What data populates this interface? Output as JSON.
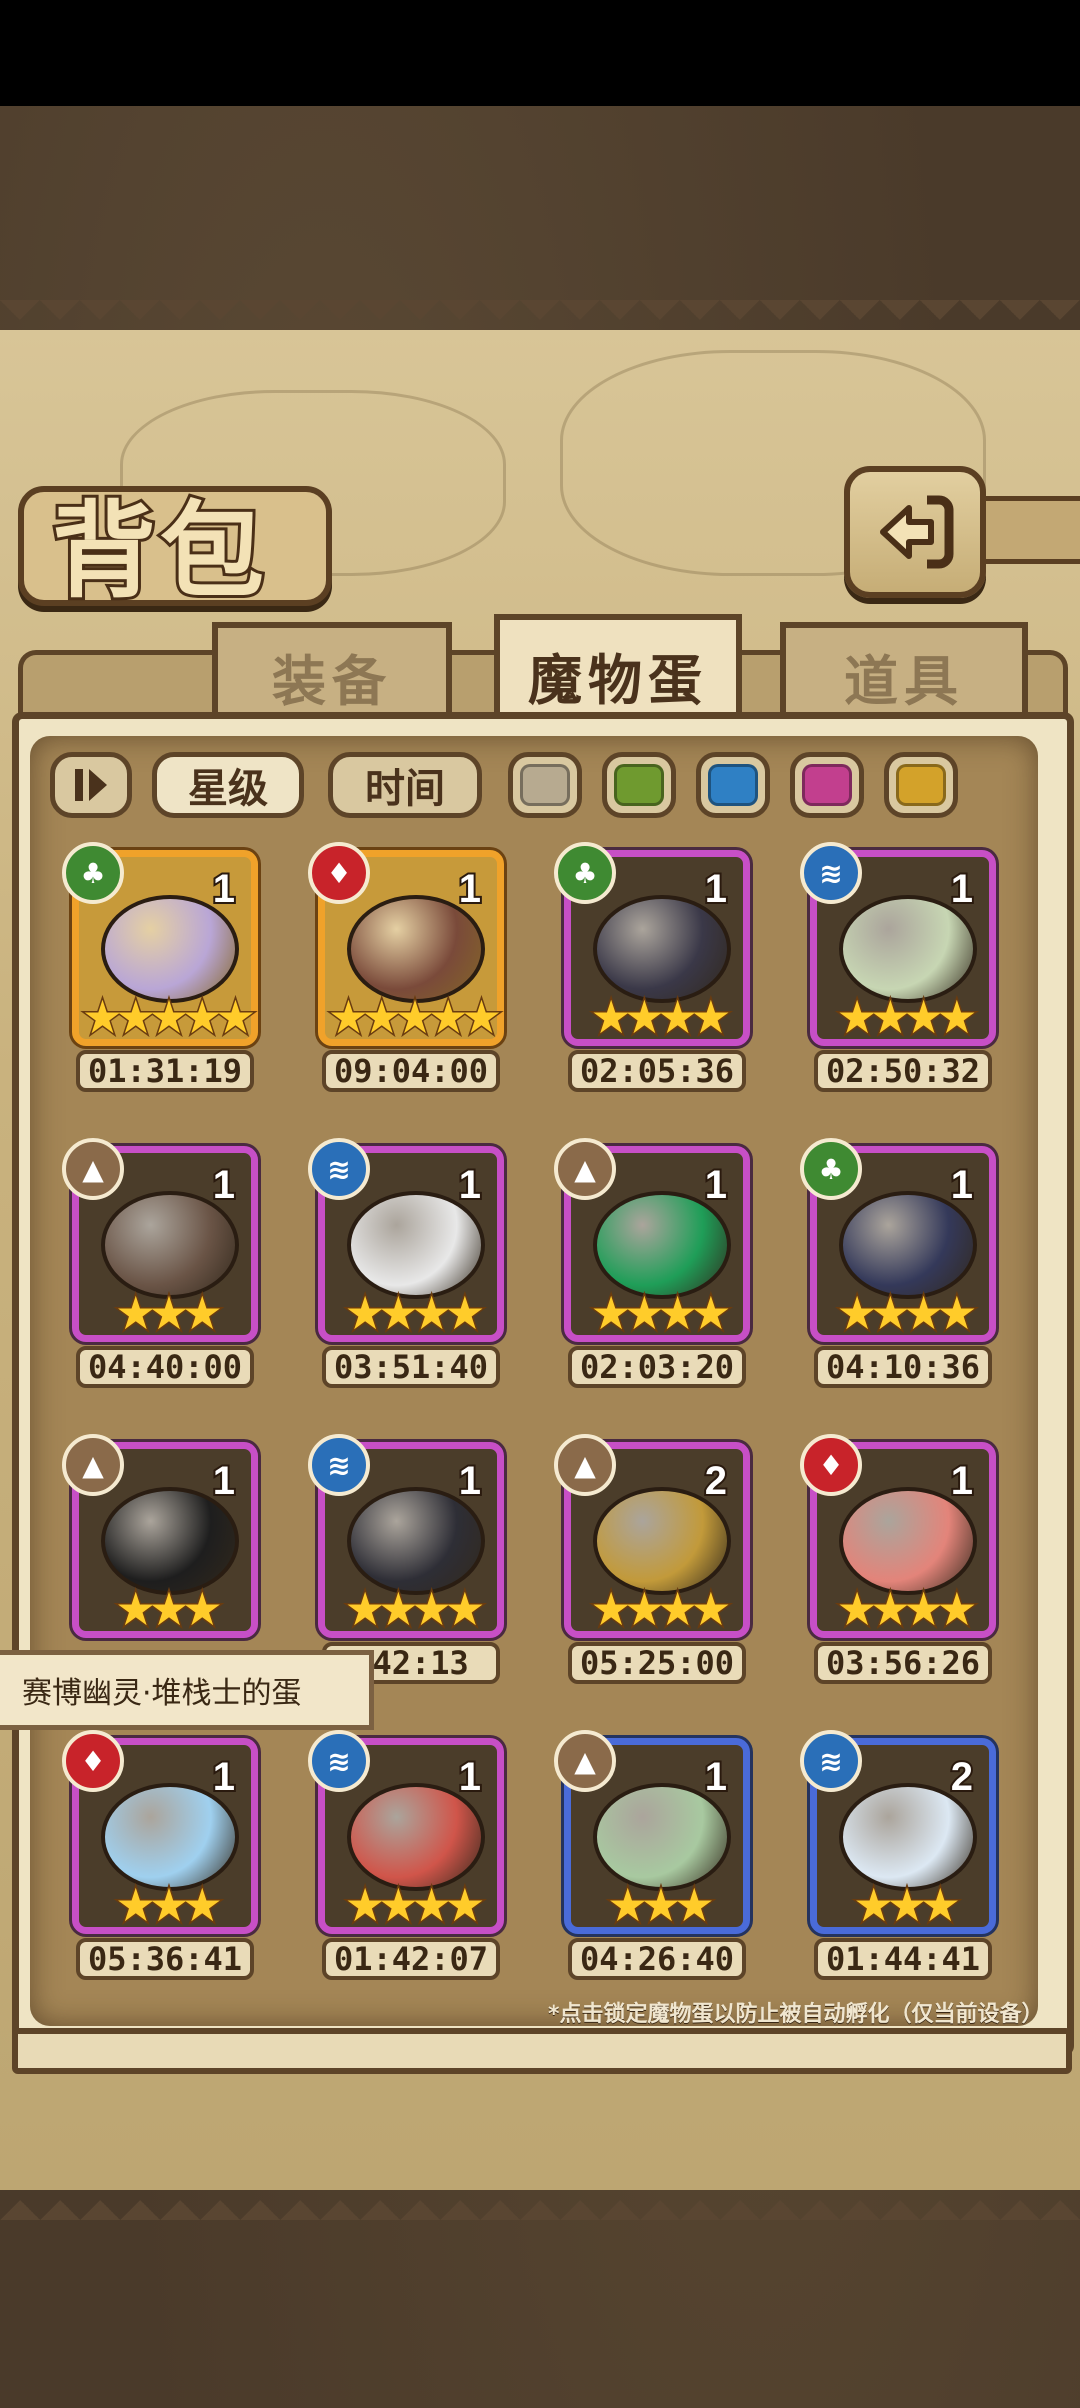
{
  "title": "背包",
  "tabs": [
    {
      "label": "装备",
      "active": false
    },
    {
      "label": "魔物蛋",
      "active": true
    },
    {
      "label": "道具",
      "active": false
    }
  ],
  "sort_buttons": {
    "star": "星级",
    "time": "时间",
    "active": "星级"
  },
  "rarity_filters": [
    "#b7aa90",
    "#6f9a2f",
    "#2f80c4",
    "#c23f8e",
    "#d3a22a"
  ],
  "eggs": [
    {
      "element": "grass",
      "count": "1",
      "stars": 5,
      "time": "01:31:19",
      "frame": "gold",
      "art": "#b9a6d6"
    },
    {
      "element": "fire",
      "count": "1",
      "stars": 5,
      "time": "09:04:00",
      "frame": "gold",
      "art": "#7a4a3a"
    },
    {
      "element": "grass",
      "count": "1",
      "stars": 4,
      "time": "02:05:36",
      "frame": "purple",
      "art": "#3a3848"
    },
    {
      "element": "water",
      "count": "1",
      "stars": 4,
      "time": "02:50:32",
      "frame": "purple",
      "art": "#c7d6b3"
    },
    {
      "element": "earth",
      "count": "1",
      "stars": 3,
      "time": "04:40:00",
      "frame": "purple",
      "art": "#6a5446"
    },
    {
      "element": "water",
      "count": "1",
      "stars": 4,
      "time": "03:51:40",
      "frame": "purple",
      "art": "#e8e8e8"
    },
    {
      "element": "earth",
      "count": "1",
      "stars": 4,
      "time": "02:03:20",
      "frame": "purple",
      "art": "#1f9e58"
    },
    {
      "element": "grass",
      "count": "1",
      "stars": 4,
      "time": "04:10:36",
      "frame": "purple",
      "art": "#34395a"
    },
    {
      "element": "earth",
      "count": "1",
      "stars": 3,
      "time": "",
      "frame": "purple",
      "art": "#1e1e1e"
    },
    {
      "element": "water",
      "count": "1",
      "stars": 4,
      "time": ":42:13",
      "frame": "purple",
      "art": "#2e2e36"
    },
    {
      "element": "earth",
      "count": "2",
      "stars": 4,
      "time": "05:25:00",
      "frame": "purple",
      "art": "#c29a3a"
    },
    {
      "element": "fire",
      "count": "1",
      "stars": 4,
      "time": "03:56:26",
      "frame": "purple",
      "art": "#e3847a"
    },
    {
      "element": "fire",
      "count": "1",
      "stars": 3,
      "time": "05:36:41",
      "frame": "purple",
      "art": "#9fd0ef"
    },
    {
      "element": "water",
      "count": "1",
      "stars": 4,
      "time": "01:42:07",
      "frame": "purple",
      "art": "#d0554a"
    },
    {
      "element": "earth",
      "count": "1",
      "stars": 3,
      "time": "04:26:40",
      "frame": "blue",
      "art": "#a8c9a0"
    },
    {
      "element": "water",
      "count": "2",
      "stars": 3,
      "time": "01:44:41",
      "frame": "blue",
      "art": "#dce8f3"
    }
  ],
  "element_colors": {
    "grass": "#3f8a32",
    "fire": "#c8232a",
    "water": "#2a6fb8",
    "earth": "#8a6a4a"
  },
  "element_glyphs": {
    "grass": "♣",
    "fire": "♦",
    "water": "≋",
    "earth": "▲"
  },
  "tooltip": "赛博幽灵·堆栈士的蛋",
  "footnote": "*点击锁定魔物蛋以防止被自动孵化（仅当前设备）"
}
